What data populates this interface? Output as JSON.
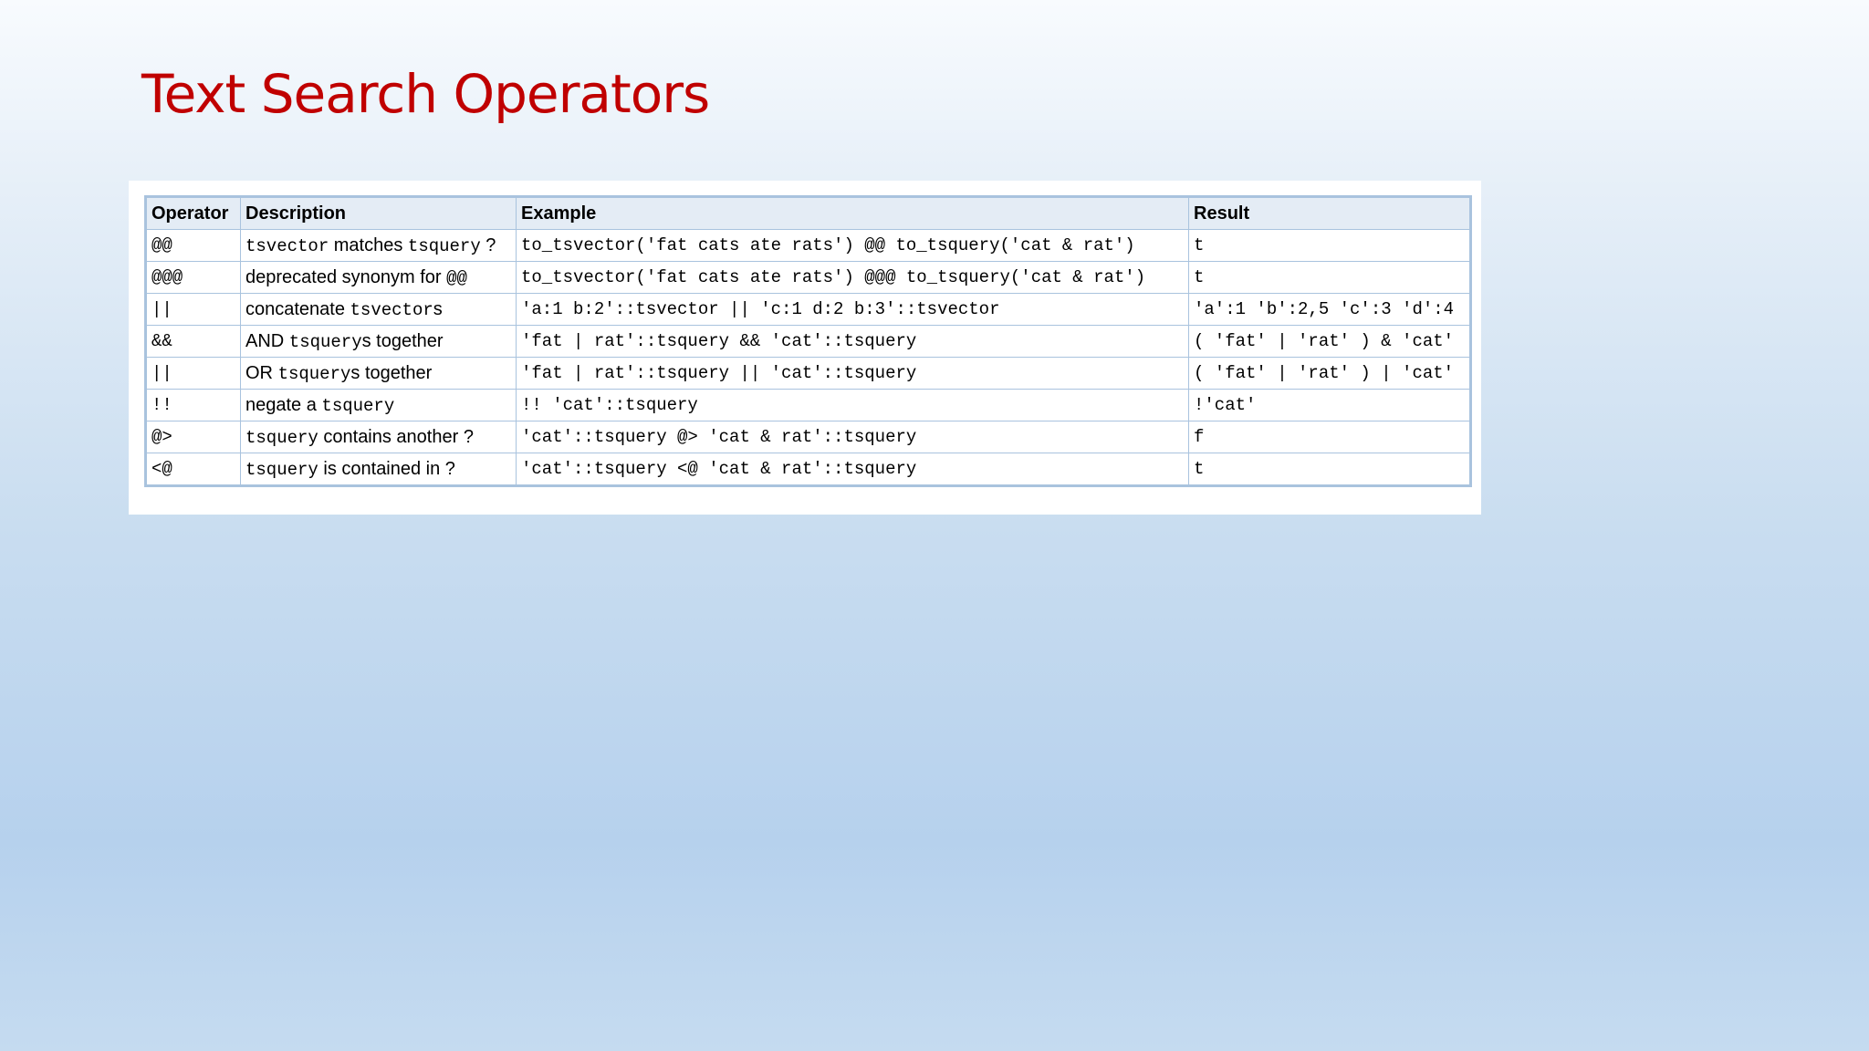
{
  "title": "Text Search Operators",
  "table": {
    "headers": [
      "Operator",
      "Description",
      "Example",
      "Result"
    ],
    "rows": [
      {
        "operator": "@@",
        "description": [
          {
            "text": "tsvector",
            "code": true
          },
          {
            "text": " matches ",
            "code": false
          },
          {
            "text": "tsquery",
            "code": true
          },
          {
            "text": " ?",
            "code": false
          }
        ],
        "example": "to_tsvector('fat cats ate rats') @@ to_tsquery('cat & rat')",
        "result": "t"
      },
      {
        "operator": "@@@",
        "description": [
          {
            "text": "deprecated synonym for ",
            "code": false
          },
          {
            "text": "@@",
            "code": true
          }
        ],
        "example": "to_tsvector('fat cats ate rats') @@@ to_tsquery('cat & rat')",
        "result": "t"
      },
      {
        "operator": "||",
        "description": [
          {
            "text": "concatenate ",
            "code": false
          },
          {
            "text": "tsvector",
            "code": true
          },
          {
            "text": "s",
            "code": false
          }
        ],
        "example": "'a:1 b:2'::tsvector || 'c:1 d:2 b:3'::tsvector",
        "result": "'a':1 'b':2,5 'c':3 'd':4"
      },
      {
        "operator": "&&",
        "description": [
          {
            "text": "AND ",
            "code": false
          },
          {
            "text": "tsquery",
            "code": true
          },
          {
            "text": "s together",
            "code": false
          }
        ],
        "example": "'fat | rat'::tsquery && 'cat'::tsquery",
        "result": "( 'fat' | 'rat' ) & 'cat'"
      },
      {
        "operator": "||",
        "description": [
          {
            "text": "OR ",
            "code": false
          },
          {
            "text": "tsquery",
            "code": true
          },
          {
            "text": "s together",
            "code": false
          }
        ],
        "example": "'fat | rat'::tsquery || 'cat'::tsquery",
        "result": "( 'fat' | 'rat' ) | 'cat'"
      },
      {
        "operator": "!!",
        "description": [
          {
            "text": "negate a ",
            "code": false
          },
          {
            "text": "tsquery",
            "code": true
          }
        ],
        "example": "!! 'cat'::tsquery",
        "result": "!'cat'"
      },
      {
        "operator": "@>",
        "description": [
          {
            "text": "tsquery",
            "code": true
          },
          {
            "text": " contains another ?",
            "code": false
          }
        ],
        "example": "'cat'::tsquery @> 'cat & rat'::tsquery",
        "result": "f"
      },
      {
        "operator": "<@",
        "description": [
          {
            "text": "tsquery",
            "code": true
          },
          {
            "text": " is contained in ?",
            "code": false
          }
        ],
        "example": "'cat'::tsquery <@ 'cat & rat'::tsquery",
        "result": "t"
      }
    ]
  }
}
